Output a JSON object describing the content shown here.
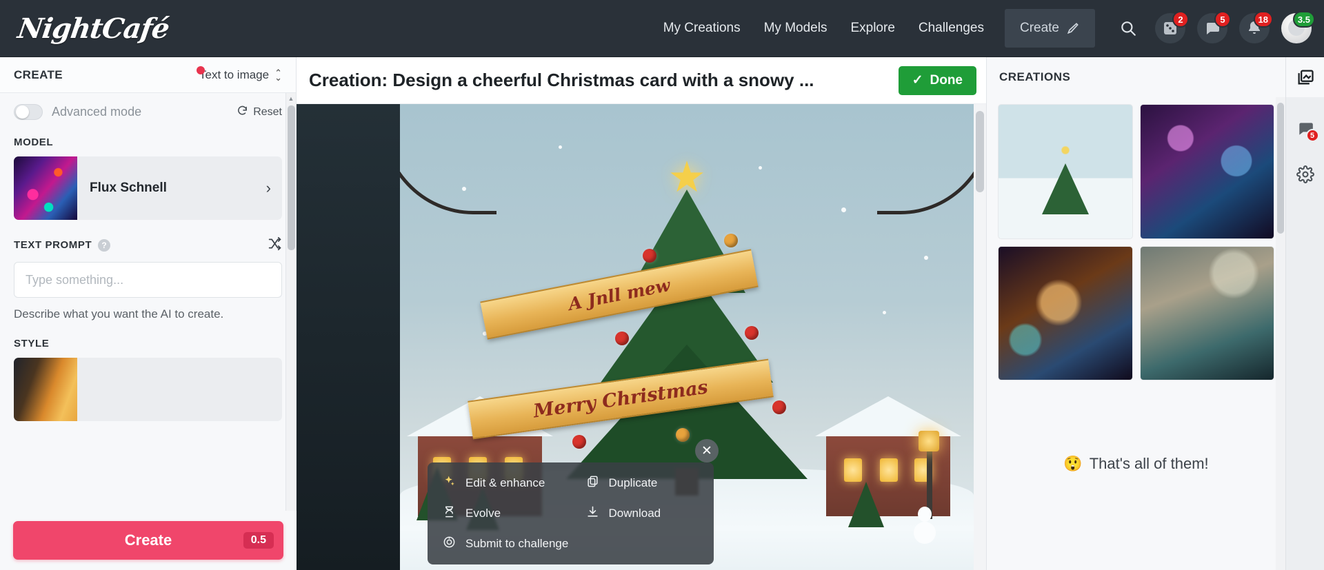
{
  "header": {
    "logo": "NightCafé",
    "nav": [
      {
        "label": "My Creations",
        "name": "nav-my-creations"
      },
      {
        "label": "My Models",
        "name": "nav-my-models"
      },
      {
        "label": "Explore",
        "name": "nav-explore"
      },
      {
        "label": "Challenges",
        "name": "nav-challenges"
      }
    ],
    "create_button": "Create",
    "icons": {
      "search": "search-icon",
      "dice": "dice-icon",
      "chat": "chat-bubble-icon",
      "bell": "bell-icon",
      "avatar": "avatar"
    },
    "badges": {
      "dice": "2",
      "chat": "5",
      "bell": "18",
      "credits": "3.5"
    }
  },
  "sidebar": {
    "title": "CREATE",
    "mode": "Text to image",
    "advanced_mode_label": "Advanced mode",
    "advanced_mode_on": false,
    "reset_label": "Reset",
    "model_section_label": "MODEL",
    "model_name": "Flux Schnell",
    "prompt_section_label": "TEXT PROMPT",
    "prompt_help": "?",
    "prompt_value": "",
    "prompt_placeholder": "Type something...",
    "prompt_helper": "Describe what you want the AI to create.",
    "style_section_label": "STYLE",
    "create_button": "Create",
    "create_credits": "0.5"
  },
  "main": {
    "title": "Creation: Design a cheerful Christmas card with a snowy ...",
    "done_button": "Done",
    "artwork": {
      "banner_top": "A Jnll mew",
      "banner_bottom": "Merry Christmas"
    },
    "context_menu": [
      {
        "label": "Edit & enhance",
        "icon": "sparkles-icon",
        "name": "menu-edit-enhance"
      },
      {
        "label": "Duplicate",
        "icon": "copy-icon",
        "name": "menu-duplicate"
      },
      {
        "label": "Evolve",
        "icon": "dna-icon",
        "name": "menu-evolve"
      },
      {
        "label": "Download",
        "icon": "download-icon",
        "name": "menu-download"
      },
      {
        "label": "Submit to challenge",
        "icon": "target-icon",
        "name": "menu-submit-challenge"
      }
    ],
    "close_label": "✕"
  },
  "creations_panel": {
    "title": "CREATIONS",
    "gallery_icon": "gallery-icon",
    "thumbnails": [
      {
        "name": "creation-thumb-christmas-tree"
      },
      {
        "name": "creation-thumb-blue-dragon"
      },
      {
        "name": "creation-thumb-dragon-globe"
      },
      {
        "name": "creation-thumb-sailing-ship"
      }
    ],
    "end_message": "That's all of them!",
    "end_emoji": "😲"
  },
  "rail": {
    "gallery_icon": "gallery-icon",
    "chat_icon": "chat-bubble-icon",
    "chat_badge": "5",
    "settings_icon": "gear-icon"
  },
  "colors": {
    "header_bg": "#2a3139",
    "accent_pink": "#f0466b",
    "done_green": "#1f9d38",
    "badge_red": "#e02020",
    "badge_green": "#1f9d38"
  }
}
